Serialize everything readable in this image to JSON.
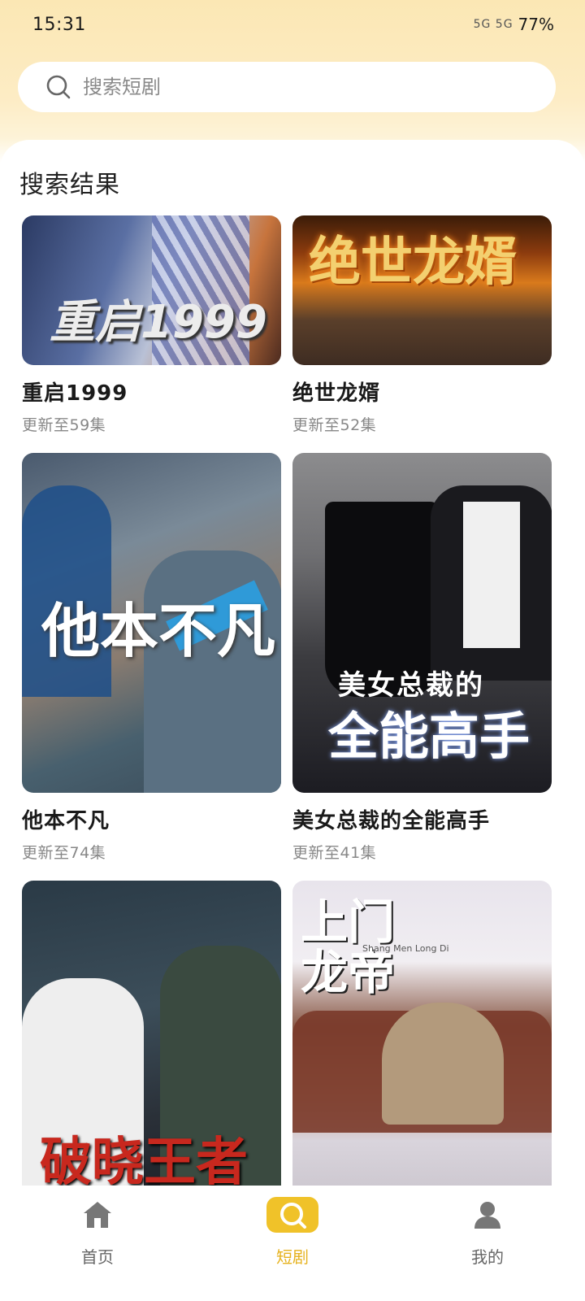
{
  "status_bar": {
    "time": "15:31",
    "indicators": "5G  5G",
    "battery": "77%"
  },
  "search": {
    "placeholder": "搜索短剧",
    "value": ""
  },
  "results": {
    "title": "搜索结果",
    "items": [
      {
        "name": "重启1999",
        "status": "更新至59集",
        "cover_text": "重启1999"
      },
      {
        "name": "绝世龙婿",
        "status": "更新至52集",
        "cover_text": "绝世龙婿"
      },
      {
        "name": "他本不凡",
        "status": "更新至74集",
        "cover_text": "他本不凡"
      },
      {
        "name": "美女总裁的全能高手",
        "status": "更新至41集",
        "cover_text_top": "美女总裁的",
        "cover_text_bottom": "全能高手"
      },
      {
        "name": "",
        "status": "",
        "cover_text": "破晓王者"
      },
      {
        "name": "",
        "status": "",
        "cover_text": "上门龙帝",
        "cover_pinyin": "Shang Men Long Di"
      }
    ]
  },
  "bottom_nav": {
    "items": [
      {
        "label": "首页",
        "icon": "home-icon",
        "active": false
      },
      {
        "label": "短剧",
        "icon": "search-icon",
        "active": true
      },
      {
        "label": "我的",
        "icon": "user-icon",
        "active": false
      }
    ]
  },
  "colors": {
    "accent": "#f0c229",
    "accent_text": "#e6b21d",
    "header_gradient": "#fbe7b4"
  }
}
